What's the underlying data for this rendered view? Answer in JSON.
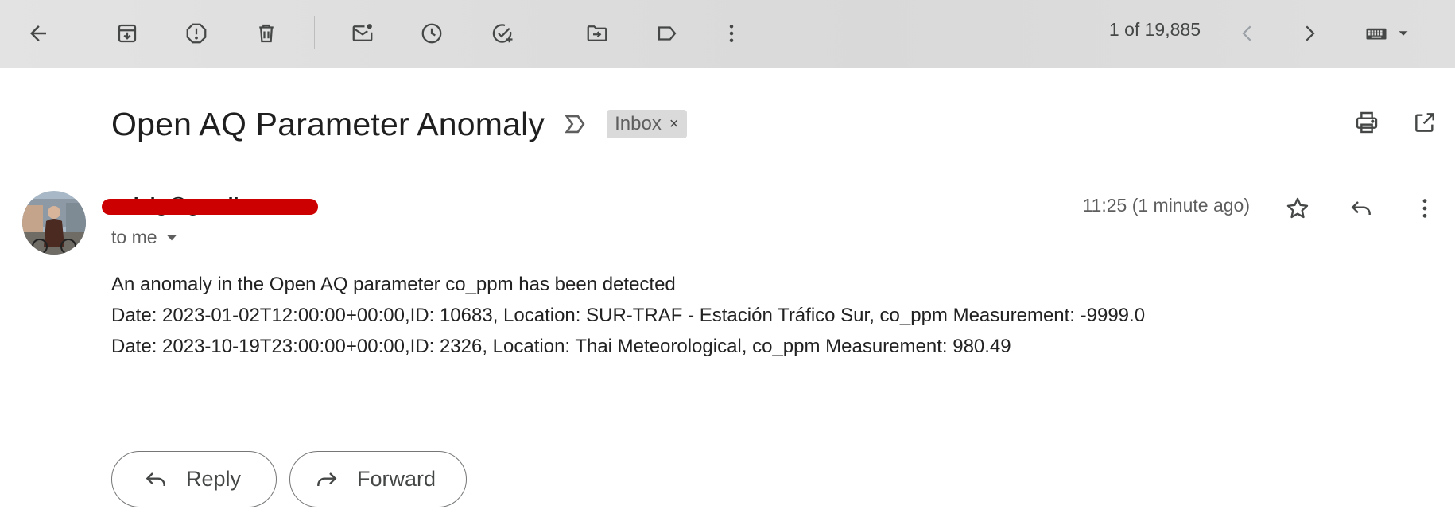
{
  "toolbar": {
    "buttons": [
      {
        "name": "back-button",
        "icon": "arrow-left-icon"
      },
      {
        "name": "archive-button",
        "icon": "archive-icon"
      },
      {
        "name": "report-spam-button",
        "icon": "report-icon"
      },
      {
        "name": "delete-button",
        "icon": "trash-icon"
      },
      {
        "name": "mark-unread-button",
        "icon": "mail-unread-icon"
      },
      {
        "name": "snooze-button",
        "icon": "clock-icon"
      },
      {
        "name": "add-to-tasks-button",
        "icon": "task-add-icon"
      },
      {
        "name": "move-to-button",
        "icon": "folder-move-icon"
      },
      {
        "name": "labels-button",
        "icon": "label-icon"
      },
      {
        "name": "more-button",
        "icon": "more-vert-icon"
      }
    ],
    "pager": "1 of 19,885"
  },
  "email": {
    "subject": "Open AQ Parameter Anomaly",
    "label": "Inbox",
    "label_remove": "×",
    "sender": "cvieig@gmail.com",
    "recipient": "to me",
    "timestamp": "11:25 (1 minute ago)",
    "body": [
      "An anomaly in the Open AQ parameter co_ppm has been detected",
      "Date: 2023-01-02T12:00:00+00:00,ID: 10683, Location: SUR-TRAF - Estación Tráfico Sur, co_ppm Measurement: -9999.0",
      "Date: 2023-10-19T23:00:00+00:00,ID: 2326, Location: Thai Meteorological, co_ppm Measurement: 980.49"
    ]
  },
  "actions": {
    "reply": "Reply",
    "forward": "Forward"
  },
  "colors": {
    "toolbar_bg": "#dcdcdc",
    "label_chip": "#dadada",
    "redaction": "#cc0000"
  }
}
